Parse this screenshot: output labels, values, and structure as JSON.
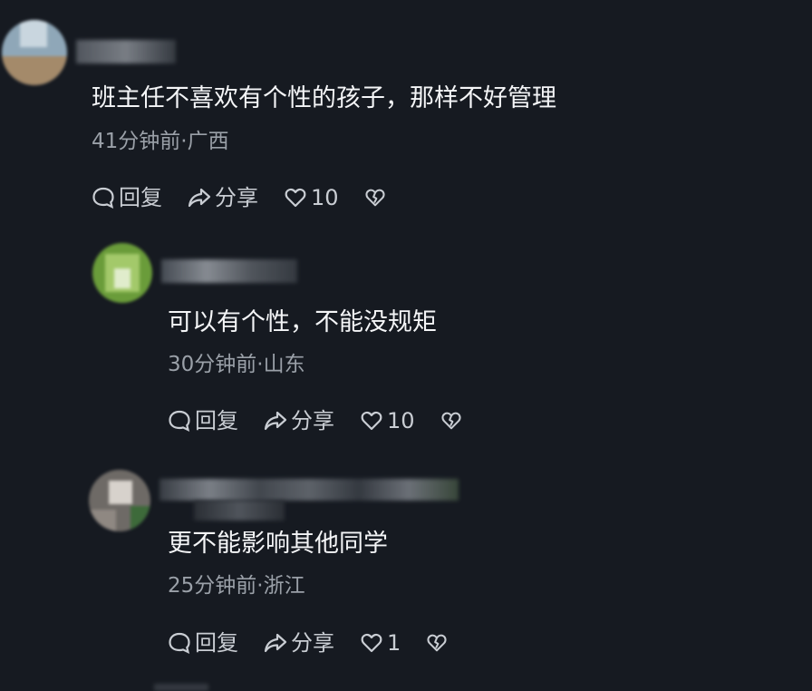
{
  "comments": [
    {
      "text": "班主任不喜欢有个性的孩子，那样不好管理",
      "meta": "41分钟前·广西",
      "reply_label": "回复",
      "share_label": "分享",
      "like_count": "10"
    },
    {
      "text": "可以有个性，不能没规矩",
      "meta": "30分钟前·山东",
      "reply_label": "回复",
      "share_label": "分享",
      "like_count": "10"
    },
    {
      "text": "更不能影响其他同学",
      "meta": "25分钟前·浙江",
      "reply_label": "回复",
      "share_label": "分享",
      "like_count": "1"
    }
  ],
  "icons": {
    "reply": "speech-bubble-icon",
    "share": "share-arrow-icon",
    "like": "heart-icon",
    "dislike": "broken-heart-icon"
  },
  "colors": {
    "background": "#161a21",
    "text": "#f4f5f7",
    "meta": "#9aa0a8",
    "action": "#c9cdd3"
  }
}
